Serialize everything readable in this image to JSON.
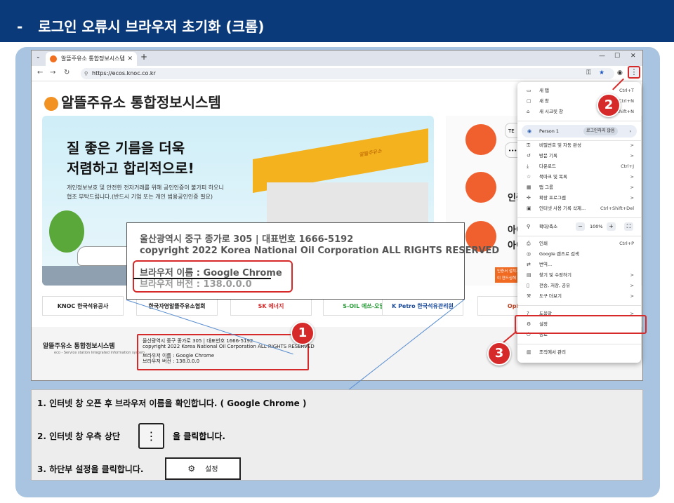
{
  "header": {
    "dash": "-",
    "title": "로그인 오류시 브라우저 초기화 (크롬)"
  },
  "browser": {
    "tab_title": "알뜰주유소 통합정보시스템",
    "url": "https://ecos.knoc.co.kr",
    "kebab": "⋮"
  },
  "page": {
    "logo": "알뜰주유소 통합정보시스템",
    "hero_heading": "질 좋은 기름을 더욱\n저렴하고 합리적으로!",
    "hero_text": "개인정보보호 및 안전한 전자거래를 위해 공인인증이 불가피 하오니\n협조 부탁드립니다.(반드시 기업 또는 개인 범용공인인증 필요)",
    "station_sign": "알뜰주유소",
    "right_login_field": "TE",
    "right_login_pw": "••••",
    "right_cert": "인증",
    "right_label1": "아이",
    "right_label2": "아이",
    "notice_line1": "인증서 설치가 안되시거나",
    "notice_line2": "이 현드심해 이기를 클릭해",
    "partners": [
      "KNOC 한국석유공사",
      "한국자영알뜰주유소협회",
      "SK 에너지",
      "S-OIL 에쓰-오일",
      "K Petro 한국석유관리원",
      "Opinet"
    ],
    "footer_logo": "알뜰주유소 통합정보시스템",
    "footer_sub": "eco - Service station Integrated information system",
    "footer_lines": [
      "울산광역시 중구 종가로 305  |  대표번호 1666-5192",
      "copyright 2022 Korea National Oil Corporation ALL RIGHTS RESERVED",
      "",
      "브라우저 이름 : Google Chrome",
      "브라우저 버전 : 138.0.0.0"
    ]
  },
  "zoom": {
    "line1": "울산광역시 중구 종가로 305  |  대표번호 1666-5192",
    "line2": "copyright 2022 Korea National Oil Corporation ALL RIGHTS RESERVED",
    "line3": "브라우저 이름 : Google Chrome",
    "line4": "브라우저 버전 : 138.0.0.0"
  },
  "menu": {
    "items_top": [
      {
        "label": "새 탭",
        "shortcut": "Ctrl+T"
      },
      {
        "label": "새 창",
        "shortcut": "Ctrl+N"
      },
      {
        "label": "새 시크릿 창",
        "shortcut": "Ctrl+Shift+N"
      }
    ],
    "person": "Person 1",
    "person_badge": "로그인하지 않음",
    "items_mid": [
      {
        "label": "비밀번호 및 자동 완성",
        "shortcut": ">"
      },
      {
        "label": "방문 기록",
        "shortcut": ">"
      },
      {
        "label": "다운로드",
        "shortcut": "Ctrl+J"
      },
      {
        "label": "북마크 및 목록",
        "shortcut": ">"
      },
      {
        "label": "탭 그룹",
        "shortcut": ">"
      },
      {
        "label": "확장 프로그램",
        "shortcut": ">"
      },
      {
        "label": "인터넷 사용 기록 삭제...",
        "shortcut": "Ctrl+Shift+Del"
      }
    ],
    "zoom_label": "확대/축소",
    "zoom_value": "100%",
    "items_low": [
      {
        "label": "인쇄",
        "shortcut": "Ctrl+P"
      },
      {
        "label": "Google 렌즈로 검색",
        "shortcut": ""
      },
      {
        "label": "번역...",
        "shortcut": ""
      },
      {
        "label": "찾기 및 수정하기",
        "shortcut": ">"
      },
      {
        "label": "전송, 저장, 공유",
        "shortcut": ">"
      },
      {
        "label": "도구 더보기",
        "shortcut": ">"
      }
    ],
    "items_bottom": [
      {
        "label": "도움말",
        "shortcut": ">"
      },
      {
        "label": "설정",
        "shortcut": ""
      },
      {
        "label": "종료",
        "shortcut": ""
      }
    ],
    "managed": "조직에서 관리"
  },
  "callouts": [
    "1",
    "2",
    "3"
  ],
  "instructions": {
    "step1": "1. 인터넷 창 오픈 후 브라우저 이름을 확인합니다. ( Google Chrome )",
    "step2a": "2. 인터넷 창 우측 상단",
    "step2_btn": "⋮",
    "step2b": "을 클릭합니다.",
    "step3": "3. 하단부 설정을 클릭합니다.",
    "step3_btn": "설정"
  },
  "colors": {
    "header_bg": "#0a3a7a",
    "highlight": "#d62a2a",
    "panel_bg": "#a8c4e0"
  }
}
